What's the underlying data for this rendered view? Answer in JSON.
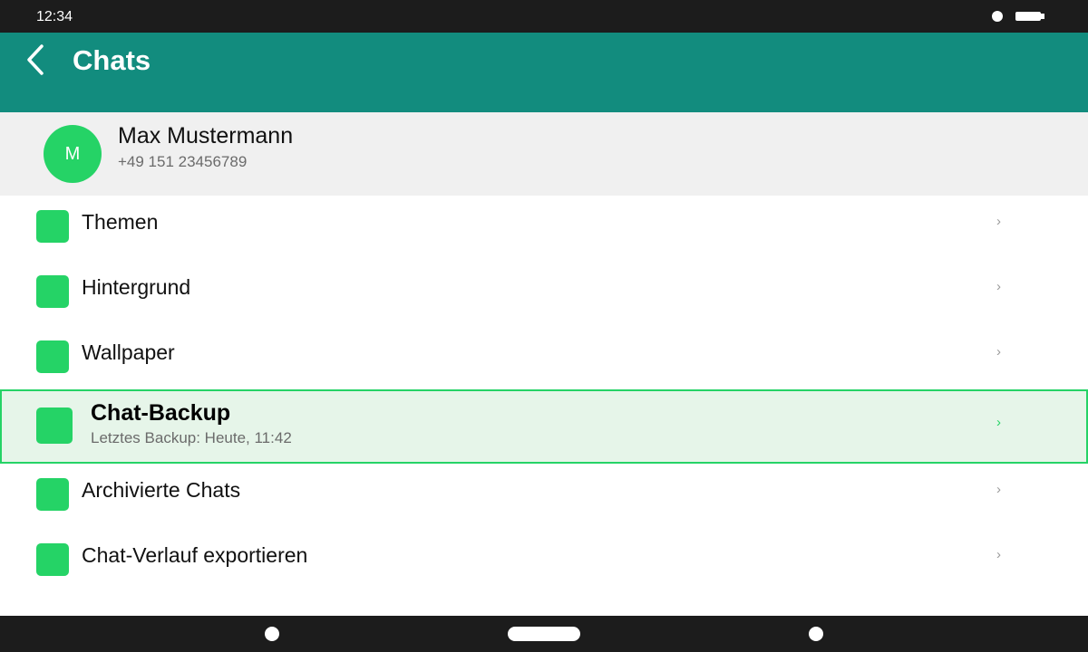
{
  "status_bar": {
    "time": "12:34"
  },
  "app_bar": {
    "title": "Chats",
    "back_icon": "chevron-left-icon"
  },
  "profile": {
    "avatar_initial": "M",
    "name": "Max Mustermann",
    "phone": "+49 151 23456789"
  },
  "settings": {
    "items": [
      {
        "label": "Themen",
        "chevron": "›"
      },
      {
        "label": "Hintergrund",
        "chevron": "›"
      },
      {
        "label": "Wallpaper",
        "chevron": "›"
      },
      {
        "label": "Chat-Backup",
        "sublabel": "Letztes Backup: Heute, 11:42",
        "chevron": "›",
        "selected": true
      },
      {
        "label": "Archivierte Chats",
        "chevron": "›"
      },
      {
        "label": "Chat-Verlauf exportieren",
        "chevron": "›"
      }
    ]
  },
  "colors": {
    "app_bar": "#128c7e",
    "accent": "#25d366",
    "selected_background": "#e6f5e9",
    "profile_background": "#f0f0f0",
    "system_bars": "#1c1c1c"
  },
  "nav_bar": {
    "buttons": [
      "back",
      "home",
      "recents"
    ]
  }
}
